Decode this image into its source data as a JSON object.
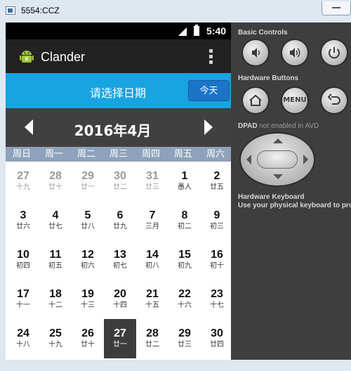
{
  "window": {
    "title": "5554:CCZ"
  },
  "status_bar": {
    "time": "5:40"
  },
  "action_bar": {
    "title": "Clander"
  },
  "header": {
    "prompt": "请选择日期",
    "today_button": "今天"
  },
  "month_nav": {
    "title": "2016年4月"
  },
  "weekdays": [
    "周日",
    "周一",
    "周二",
    "周三",
    "周四",
    "周五",
    "周六"
  ],
  "calendar": {
    "weeks": [
      [
        {
          "d": "27",
          "l": "十九",
          "grey": true
        },
        {
          "d": "28",
          "l": "廿十",
          "grey": true
        },
        {
          "d": "29",
          "l": "廿一",
          "grey": true
        },
        {
          "d": "30",
          "l": "廿二",
          "grey": true
        },
        {
          "d": "31",
          "l": "廿三",
          "grey": true
        },
        {
          "d": "1",
          "l": "愚人"
        },
        {
          "d": "2",
          "l": "廿五"
        }
      ],
      [
        {
          "d": "3",
          "l": "廿六"
        },
        {
          "d": "4",
          "l": "廿七"
        },
        {
          "d": "5",
          "l": "廿八"
        },
        {
          "d": "6",
          "l": "廿九"
        },
        {
          "d": "7",
          "l": "三月"
        },
        {
          "d": "8",
          "l": "初二"
        },
        {
          "d": "9",
          "l": "初三"
        }
      ],
      [
        {
          "d": "10",
          "l": "初四"
        },
        {
          "d": "11",
          "l": "初五"
        },
        {
          "d": "12",
          "l": "初六"
        },
        {
          "d": "13",
          "l": "初七"
        },
        {
          "d": "14",
          "l": "初八"
        },
        {
          "d": "15",
          "l": "初九"
        },
        {
          "d": "16",
          "l": "初十"
        }
      ],
      [
        {
          "d": "17",
          "l": "十一"
        },
        {
          "d": "18",
          "l": "十二"
        },
        {
          "d": "19",
          "l": "十三"
        },
        {
          "d": "20",
          "l": "十四"
        },
        {
          "d": "21",
          "l": "十五"
        },
        {
          "d": "22",
          "l": "十六"
        },
        {
          "d": "23",
          "l": "十七"
        }
      ],
      [
        {
          "d": "24",
          "l": "十八"
        },
        {
          "d": "25",
          "l": "十九"
        },
        {
          "d": "26",
          "l": "廿十"
        },
        {
          "d": "27",
          "l": "廿一",
          "selected": true
        },
        {
          "d": "28",
          "l": "廿二"
        },
        {
          "d": "29",
          "l": "廿三"
        },
        {
          "d": "30",
          "l": "廿四"
        }
      ]
    ]
  },
  "emulator_panel": {
    "basic_controls_label": "Basic Controls",
    "hardware_buttons_label": "Hardware Buttons",
    "menu_label": "MENU",
    "dpad_label": "DPAD",
    "dpad_note": "not enabled in AVD",
    "keyboard_label": "Hardware Keyboard",
    "keyboard_note": "Use your physical keyboard to provi"
  },
  "colors": {
    "header_blue": "#17a4e0",
    "today_button": "#1c74c8",
    "month_bar": "#404040",
    "weekday_bar": "#8fa2bb",
    "selected_cell": "#3c3c3c"
  }
}
